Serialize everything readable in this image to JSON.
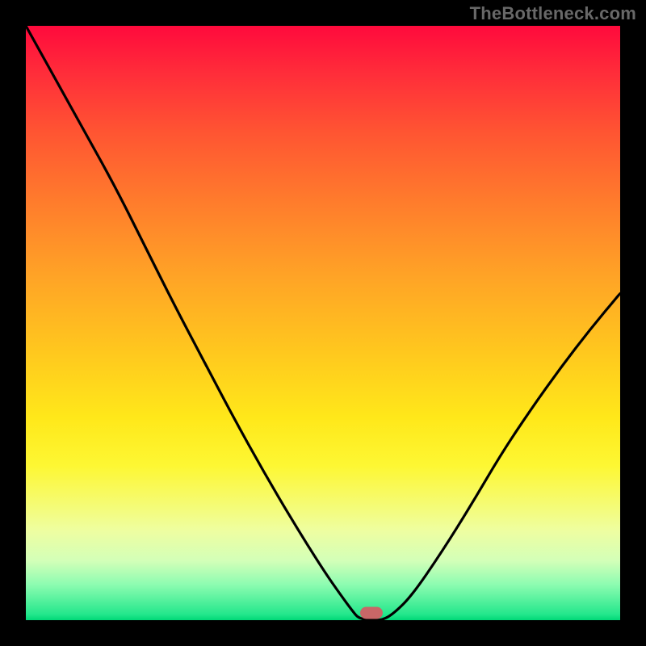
{
  "watermark": "TheBottleneck.com",
  "colors": {
    "frame_bg": "#000000",
    "gradient_top": "#ff0a3c",
    "gradient_bottom": "#00d877",
    "curve_stroke": "#000000",
    "marker_fill": "#c86767",
    "watermark_text": "#686868"
  },
  "chart_data": {
    "type": "line",
    "title": "",
    "xlabel": "",
    "ylabel": "",
    "xlim": [
      0,
      100
    ],
    "ylim": [
      0,
      100
    ],
    "grid": false,
    "legend": false,
    "description": "Single black curve over a vertical red-to-green heat gradient. Curve starts at top-left, descends along a convex arc to a flat minimum at y≈0 around x≈56–60, then rises along a convex arc toward the right reaching roughly y≈55 at x=100. A small rounded red marker sits on the flat minimum.",
    "series": [
      {
        "name": "curve",
        "x": [
          0,
          5,
          10,
          15,
          20,
          25,
          30,
          35,
          40,
          45,
          50,
          53,
          55,
          56,
          58,
          60,
          62,
          65,
          70,
          75,
          80,
          85,
          90,
          95,
          100
        ],
        "values": [
          100,
          91,
          82,
          73,
          63,
          53,
          43.5,
          34,
          25,
          16.5,
          8.5,
          4.2,
          1.5,
          0.3,
          0,
          0,
          1.2,
          4.2,
          11.5,
          19.5,
          28,
          35.5,
          42.5,
          49,
          55
        ]
      }
    ],
    "marker": {
      "x": 58.2,
      "y": 1.2
    },
    "background": "vertical-gradient red→orange→yellow→green"
  }
}
